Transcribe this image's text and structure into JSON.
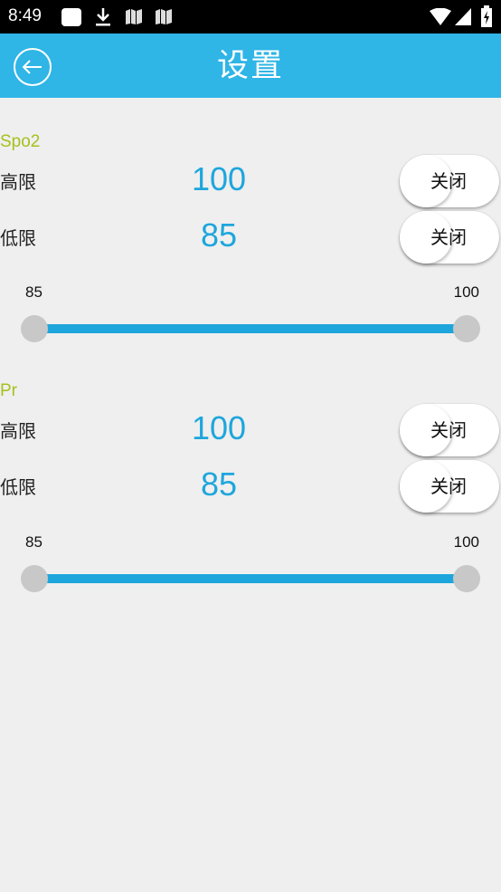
{
  "status_bar": {
    "time": "8:49"
  },
  "header": {
    "title": "设置",
    "back_icon": "arrow-left-circle-icon"
  },
  "sections": [
    {
      "title": "Spo2",
      "high": {
        "label": "高限",
        "value": "100",
        "toggle_label": "关闭"
      },
      "low": {
        "label": "低限",
        "value": "85",
        "toggle_label": "关闭"
      },
      "range": {
        "min_label": "85",
        "max_label": "100",
        "min": 85,
        "max": 100
      }
    },
    {
      "title": "Pr",
      "high": {
        "label": "高限",
        "value": "100",
        "toggle_label": "关闭"
      },
      "low": {
        "label": "低限",
        "value": "85",
        "toggle_label": "关闭"
      },
      "range": {
        "min_label": "85",
        "max_label": "100",
        "min": 85,
        "max": 100
      }
    }
  ],
  "colors": {
    "app_bar": "#2fb5e6",
    "accent": "#1ea6dc",
    "section_title": "#a6c11c",
    "background": "#efefef"
  }
}
